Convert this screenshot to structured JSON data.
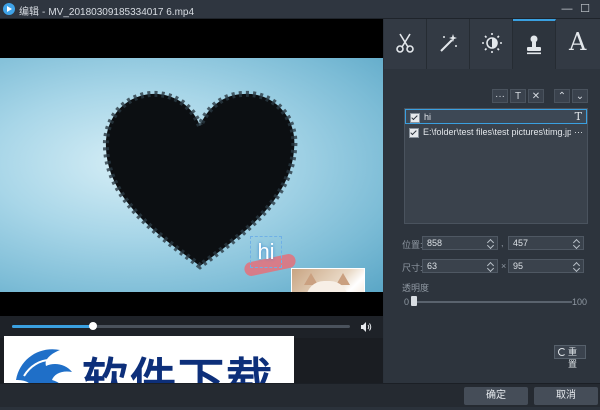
{
  "window": {
    "title_prefix": "编辑",
    "separator": "-",
    "filename": "MV_20180309185334017 6.mp4",
    "minimize": "—",
    "close": "☐"
  },
  "player": {
    "overlay_text": "hi",
    "progress": 0.24,
    "volume_icon": "speaker-icon"
  },
  "tabs": [
    {
      "icon": "scissors-icon"
    },
    {
      "icon": "magic-wand-icon"
    },
    {
      "icon": "brightness-icon"
    },
    {
      "icon": "stamp-icon",
      "active": true
    },
    {
      "icon": "text-icon",
      "glyph": "A"
    }
  ],
  "layer_toolbar": {
    "more": "···",
    "text": "T",
    "delete": "✕",
    "up": "⌃",
    "down": "⌄"
  },
  "layers": [
    {
      "label": "hi",
      "kind": "T",
      "checked": true,
      "selected": true
    },
    {
      "label": "E:\\folder\\test files\\test pictures\\timg.jp",
      "kind": "···",
      "checked": true,
      "selected": false
    }
  ],
  "properties": {
    "position_label": "位置:",
    "position_x": "858",
    "position_y": "457",
    "size_label": "尺寸:",
    "size_w": "63",
    "size_h": "95",
    "times": "×",
    "opacity_label": "透明度",
    "opacity_min": "0",
    "opacity_max": "100",
    "opacity_value": 0
  },
  "reset_button": "重置",
  "footer": {
    "ok": "确定",
    "cancel": "取消"
  },
  "watermark": {
    "text": "软件下载"
  },
  "colors": {
    "accent": "#3aa0e0",
    "panel": "#2d343d",
    "watermark_text": "#0d2f7a"
  }
}
